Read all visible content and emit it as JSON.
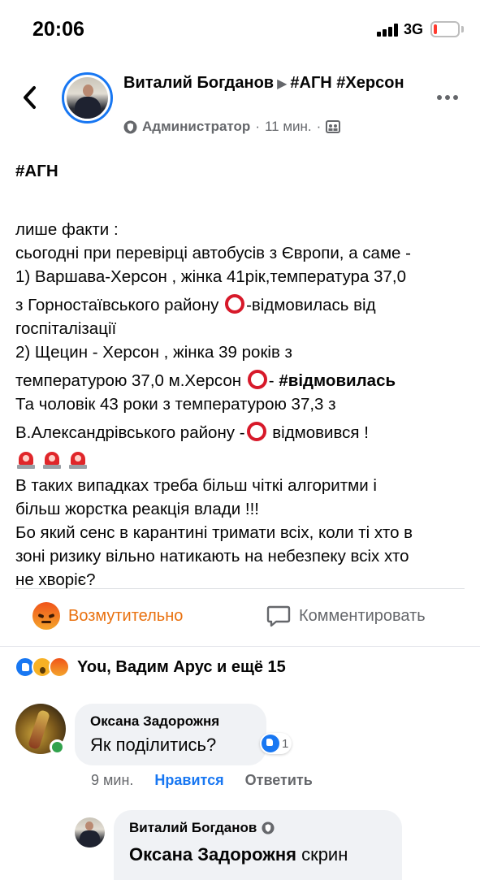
{
  "status_bar": {
    "time": "20:06",
    "network": "3G"
  },
  "post": {
    "author": "Виталий Богданов",
    "group": "#АГН #Херсон",
    "role": "Администратор",
    "time": "11 мин.",
    "separator": "·",
    "body": {
      "hashtag": "#АГН",
      "line1": "лише факти :",
      "line2": "сьогодні при перевірці автобусів з Європи, а саме -",
      "line3": "1) Варшава-Херсон , жінка 41рік,температура 37,0",
      "line4a": "з Горностаївського району ",
      "line4b": "-відмовилась від",
      "line5": "госпіталізації",
      "line6": "2) Щецин - Херсон , жінка 39 років з",
      "line7a": "температурою 37,0 м.Херсон ",
      "line7b": "- ",
      "line7c": "#відмовилась",
      "line8": "Та чоловік 43 роки з температурою 37,3 з",
      "line9a": "В.Александрівського району -",
      "line9b": " відмовився !",
      "line10": "В таких випадках треба більш чіткі алгоритми і",
      "line11": "більш жорстка реакція влади !!!",
      "line12": "Бо який сенс в карантині тримати всіх, коли ті хто в",
      "line13": "зоні ризику вільно натикають на небезпеку всіх хто",
      "line14": "не хворіє?"
    },
    "actions": {
      "reaction_label": "Возмутительно",
      "comment_label": "Комментировать"
    },
    "reactions_summary": "You, Вадим Арус и ещё 15"
  },
  "comments": [
    {
      "author": "Оксана Задорожня",
      "text": "Як поділитись?",
      "likes": "1",
      "time": "9 мин.",
      "like_label": "Нравится",
      "reply_label": "Ответить"
    }
  ],
  "reply": {
    "author": "Виталий Богданов",
    "mention": "Оксана Задорожня",
    "text": " скрин"
  },
  "colors": {
    "accent": "#1877f2",
    "angry": "#e9710f",
    "muted": "#65676b",
    "bubble": "#f0f2f5",
    "online": "#31a24c",
    "red_circle": "#d7192a"
  }
}
